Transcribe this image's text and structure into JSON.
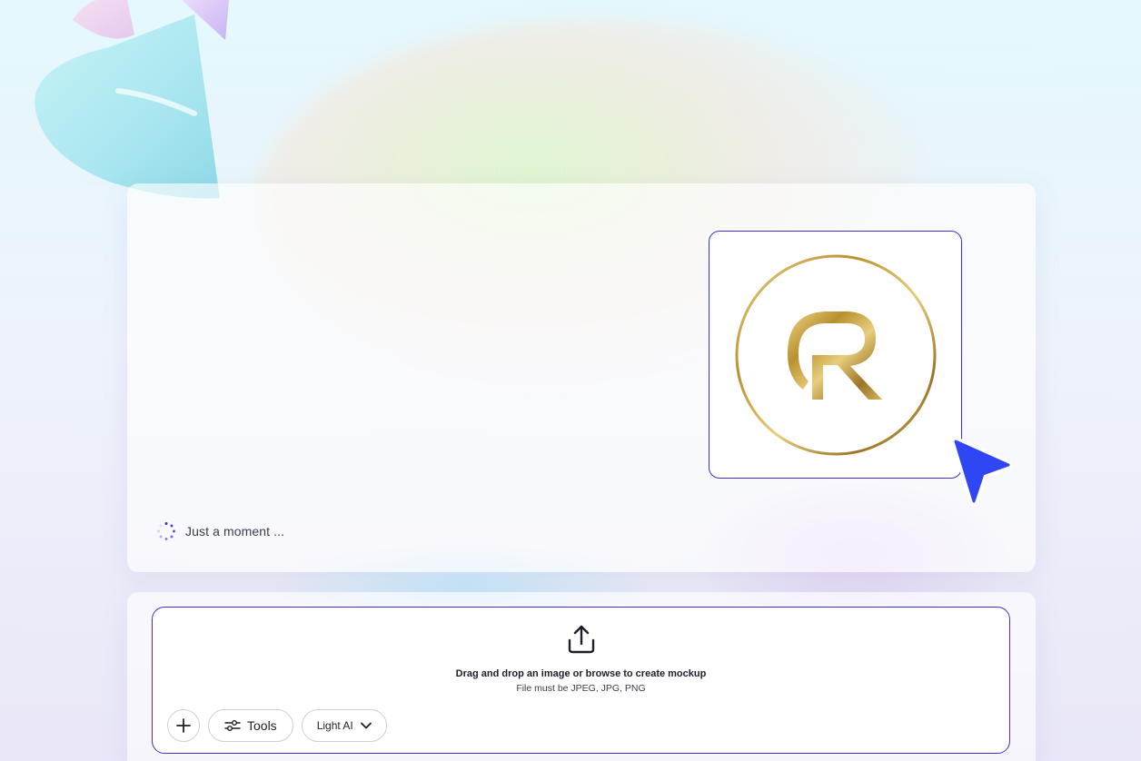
{
  "preview": {
    "status_text": "Just a moment ..."
  },
  "upload": {
    "title": "Drag and drop an image or browse to create mockup",
    "subtitle": "File must be JPEG, JPG, PNG"
  },
  "toolbar": {
    "add_icon": "plus-icon",
    "tools_label": "Tools",
    "tools_icon": "sliders-icon",
    "model_label": "Light AI",
    "model_icon": "chevron-down-icon"
  },
  "colors": {
    "accent": "#3f2fd1",
    "cursor": "#2f46f5",
    "gold": "#b8902f"
  }
}
